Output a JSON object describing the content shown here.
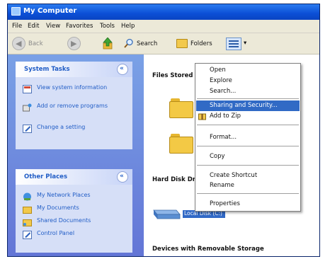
{
  "window": {
    "title": "My Computer"
  },
  "menubar": {
    "items": [
      "File",
      "Edit",
      "View",
      "Favorites",
      "Tools",
      "Help"
    ]
  },
  "toolbar": {
    "back_label": "Back",
    "search_label": "Search",
    "folders_label": "Folders"
  },
  "sidebar": {
    "system_tasks": {
      "title": "System Tasks",
      "toggle": "«",
      "items": [
        {
          "label": "View system information",
          "icon": "system-info-icon"
        },
        {
          "label": "Add or remove programs",
          "icon": "add-remove-programs-icon"
        },
        {
          "label": "Change a setting",
          "icon": "control-panel-icon"
        }
      ]
    },
    "other_places": {
      "title": "Other Places",
      "toggle": "«",
      "items": [
        {
          "label": "My Network Places",
          "icon": "network-places-icon"
        },
        {
          "label": "My Documents",
          "icon": "my-documents-icon"
        },
        {
          "label": "Shared Documents",
          "icon": "shared-documents-icon"
        },
        {
          "label": "Control Panel",
          "icon": "control-panel-icon"
        }
      ]
    }
  },
  "content": {
    "group_files": "Files Stored on This Computer",
    "group_hdd": "Hard Disk Drives",
    "drive_label": "Local Disk (C:)",
    "group_removable": "Devices with Removable Storage"
  },
  "context_menu": {
    "items": [
      "Open",
      "Explore",
      "Search...",
      "Sharing and Security...",
      "Add to Zip",
      "Format...",
      "Copy",
      "Create Shortcut",
      "Rename",
      "Properties"
    ],
    "selected": "Sharing and Security..."
  },
  "colors": {
    "title_bar": "#0b4fd6",
    "selection": "#316ac5",
    "task_link": "#215dc6",
    "sidebar": "#6f8ee0"
  }
}
